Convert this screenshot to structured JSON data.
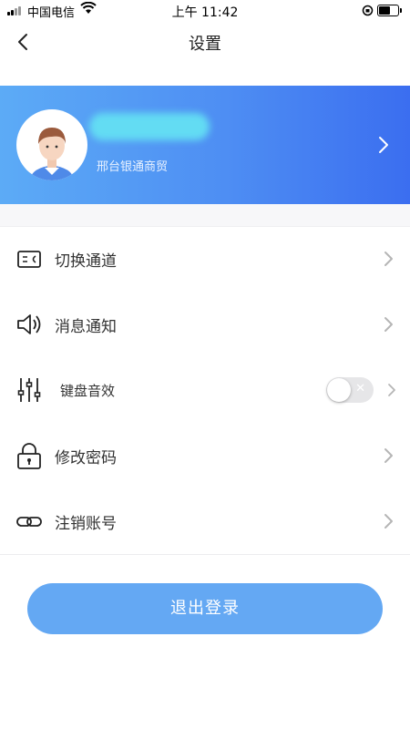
{
  "status_bar": {
    "carrier": "中国电信",
    "time": "上午 11:42"
  },
  "header": {
    "title": "设置"
  },
  "profile": {
    "company": "邢台银通商贸"
  },
  "menu": {
    "items": [
      {
        "label": "切换通道",
        "icon": "switch-channel-icon"
      },
      {
        "label": "消息通知",
        "icon": "speaker-icon"
      },
      {
        "label": "键盘音效",
        "icon": "equalizer-icon",
        "toggle": false
      },
      {
        "label": "修改密码",
        "icon": "lock-icon"
      },
      {
        "label": "注销账号",
        "icon": "link-icon"
      }
    ]
  },
  "logout": {
    "label": "退出登录"
  },
  "colors": {
    "banner_start": "#5cabf6",
    "banner_end": "#3b6ef0",
    "logout_button": "#64a8f3"
  }
}
